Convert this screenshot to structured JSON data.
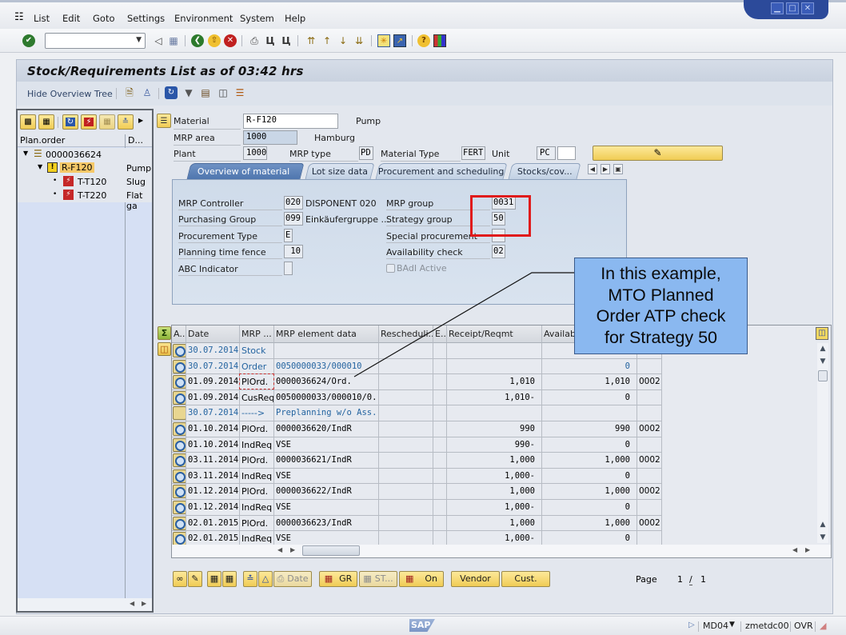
{
  "menu": {
    "items": [
      "List",
      "Edit",
      "Goto",
      "Settings",
      "Environment",
      "System",
      "Help"
    ]
  },
  "window_controls": {
    "minimize": "minimize",
    "maximize": "maximize",
    "close": "close"
  },
  "toolbar": {
    "command_field_value": "",
    "icons": [
      "enter-icon",
      "back-icon",
      "save-icon",
      "back-green-icon",
      "exit-icon",
      "cancel-icon",
      "print-icon",
      "find-icon",
      "find-next-icon",
      "first-page-icon",
      "prev-page-icon",
      "next-page-icon",
      "last-page-icon",
      "new-session-icon",
      "shortcut-icon",
      "help-icon",
      "layout-icon"
    ]
  },
  "title": "Stock/Requirements List as of 03:42 hrs",
  "app_toolbar": {
    "hide_tree_label": "Hide Overview Tree"
  },
  "tree": {
    "col1_header": "Plan.order",
    "col2_header": "D...",
    "rows": [
      {
        "label": "0000036624",
        "desc": "",
        "level": 0
      },
      {
        "label": "R-F120",
        "desc": "Pump",
        "level": 1
      },
      {
        "label": "T-T120",
        "desc": "Slug fo",
        "level": 2
      },
      {
        "label": "T-T220",
        "desc": "Flat ga",
        "level": 2
      }
    ]
  },
  "header": {
    "material_label": "Material",
    "material_value": "R-F120",
    "material_desc": "Pump",
    "mrp_area_label": "MRP area",
    "mrp_area_value": "1000",
    "mrp_area_desc": "Hamburg",
    "plant_label": "Plant",
    "plant_value": "1000",
    "mrp_type_label": "MRP type",
    "mrp_type_value": "PD",
    "material_type_label": "Material Type",
    "material_type_value": "FERT",
    "unit_label": "Unit",
    "unit_value": "PC"
  },
  "tabs": [
    {
      "label": "Overview of material data",
      "active": true
    },
    {
      "label": "Lot size data",
      "active": false
    },
    {
      "label": "Procurement and scheduling",
      "active": false
    },
    {
      "label": "Stocks/cov...",
      "active": false
    }
  ],
  "overview": {
    "mrp_controller_label": "MRP Controller",
    "mrp_controller_value": "020",
    "mrp_controller_desc": "DISPONENT 020",
    "purchasing_group_label": "Purchasing Group",
    "purchasing_group_value": "099",
    "purchasing_group_desc": "Einkäufergruppe ...",
    "procurement_type_label": "Procurement Type",
    "procurement_type_value": "E",
    "planning_time_fence_label": "Planning time fence",
    "planning_time_fence_value": "10",
    "abc_indicator_label": "ABC Indicator",
    "abc_indicator_value": "",
    "mrp_group_label": "MRP group",
    "mrp_group_value": "0031",
    "strategy_group_label": "Strategy group",
    "strategy_group_value": "50",
    "special_procurement_label": "Special procurement",
    "special_procurement_value": "",
    "availability_check_label": "Availability check",
    "availability_check_value": "02",
    "badi_active_label": "BAdI Active",
    "badi_active_checked": false
  },
  "callout": {
    "lines": [
      "In this example,",
      "MTO Planned",
      "Order ATP check",
      "for Strategy 50"
    ]
  },
  "grid": {
    "columns": [
      "A..",
      "Date",
      "MRP ...",
      "MRP element data",
      "Rescheduli...",
      "E..",
      "Receipt/Reqmt",
      "Available ...",
      ""
    ],
    "rows": [
      {
        "date": "30.07.2014",
        "mrp": "Stock",
        "data": "",
        "resched": "",
        "e": "",
        "receipt": "",
        "available": "",
        "extra": "",
        "blue": true,
        "icon": "detail"
      },
      {
        "date": "30.07.2014",
        "mrp": "Order",
        "data": "0050000033/000010",
        "resched": "",
        "e": "",
        "receipt": "",
        "available": "0",
        "extra": "",
        "blue": true,
        "icon": "detail"
      },
      {
        "date": "01.09.2014",
        "mrp": "PlOrd.",
        "data": "0000036624/Ord.",
        "resched": "",
        "e": "",
        "receipt": "1,010",
        "available": "1,010",
        "extra": "0002",
        "blue": false,
        "icon": "detail"
      },
      {
        "date": "01.09.2014",
        "mrp": "CusReq",
        "data": "0050000033/000010/0...",
        "resched": "",
        "e": "",
        "receipt": "1,010-",
        "available": "0",
        "extra": "",
        "blue": false,
        "icon": "detail"
      },
      {
        "date": "30.07.2014",
        "mrp": "----->",
        "data": "Preplanning w/o Ass...",
        "resched": "",
        "e": "",
        "receipt": "",
        "available": "",
        "extra": "",
        "blue": true,
        "icon": "plain"
      },
      {
        "date": "01.10.2014",
        "mrp": "PlOrd.",
        "data": "0000036620/IndR",
        "resched": "",
        "e": "",
        "receipt": "990",
        "available": "990",
        "extra": "0002",
        "blue": false,
        "icon": "detail"
      },
      {
        "date": "01.10.2014",
        "mrp": "IndReq",
        "data": "VSE",
        "resched": "",
        "e": "",
        "receipt": "990-",
        "available": "0",
        "extra": "",
        "blue": false,
        "icon": "detail"
      },
      {
        "date": "03.11.2014",
        "mrp": "PlOrd.",
        "data": "0000036621/IndR",
        "resched": "",
        "e": "",
        "receipt": "1,000",
        "available": "1,000",
        "extra": "0002",
        "blue": false,
        "icon": "detail"
      },
      {
        "date": "03.11.2014",
        "mrp": "IndReq",
        "data": "VSE",
        "resched": "",
        "e": "",
        "receipt": "1,000-",
        "available": "0",
        "extra": "",
        "blue": false,
        "icon": "detail"
      },
      {
        "date": "01.12.2014",
        "mrp": "PlOrd.",
        "data": "0000036622/IndR",
        "resched": "",
        "e": "",
        "receipt": "1,000",
        "available": "1,000",
        "extra": "0002",
        "blue": false,
        "icon": "detail"
      },
      {
        "date": "01.12.2014",
        "mrp": "IndReq",
        "data": "VSE",
        "resched": "",
        "e": "",
        "receipt": "1,000-",
        "available": "0",
        "extra": "",
        "blue": false,
        "icon": "detail"
      },
      {
        "date": "02.01.2015",
        "mrp": "PlOrd.",
        "data": "0000036623/IndR",
        "resched": "",
        "e": "",
        "receipt": "1,000",
        "available": "1,000",
        "extra": "0002",
        "blue": false,
        "icon": "detail"
      },
      {
        "date": "02.01.2015",
        "mrp": "IndReq",
        "data": "VSE",
        "resched": "",
        "e": "",
        "receipt": "1,000-",
        "available": "0",
        "extra": "",
        "blue": false,
        "icon": "detail"
      }
    ]
  },
  "bottom_bar": {
    "date_label": "Date",
    "gr_label": "GR",
    "st_label": "ST...",
    "on_label": "On",
    "vendor_label": "Vendor",
    "cust_label": "Cust.",
    "page_label": "Page",
    "page_current": "1",
    "page_sep": "/",
    "page_total": "1"
  },
  "status_bar": {
    "logo": "SAP",
    "transaction": "MD04",
    "server": "zmetdc00",
    "mode": "OVR"
  },
  "colors": {
    "highlight_red": "#e01b1b",
    "callout_fill": "#8ab8f0",
    "active_tab": "#5a7fb6",
    "button_yellow": "#f3d46a"
  }
}
